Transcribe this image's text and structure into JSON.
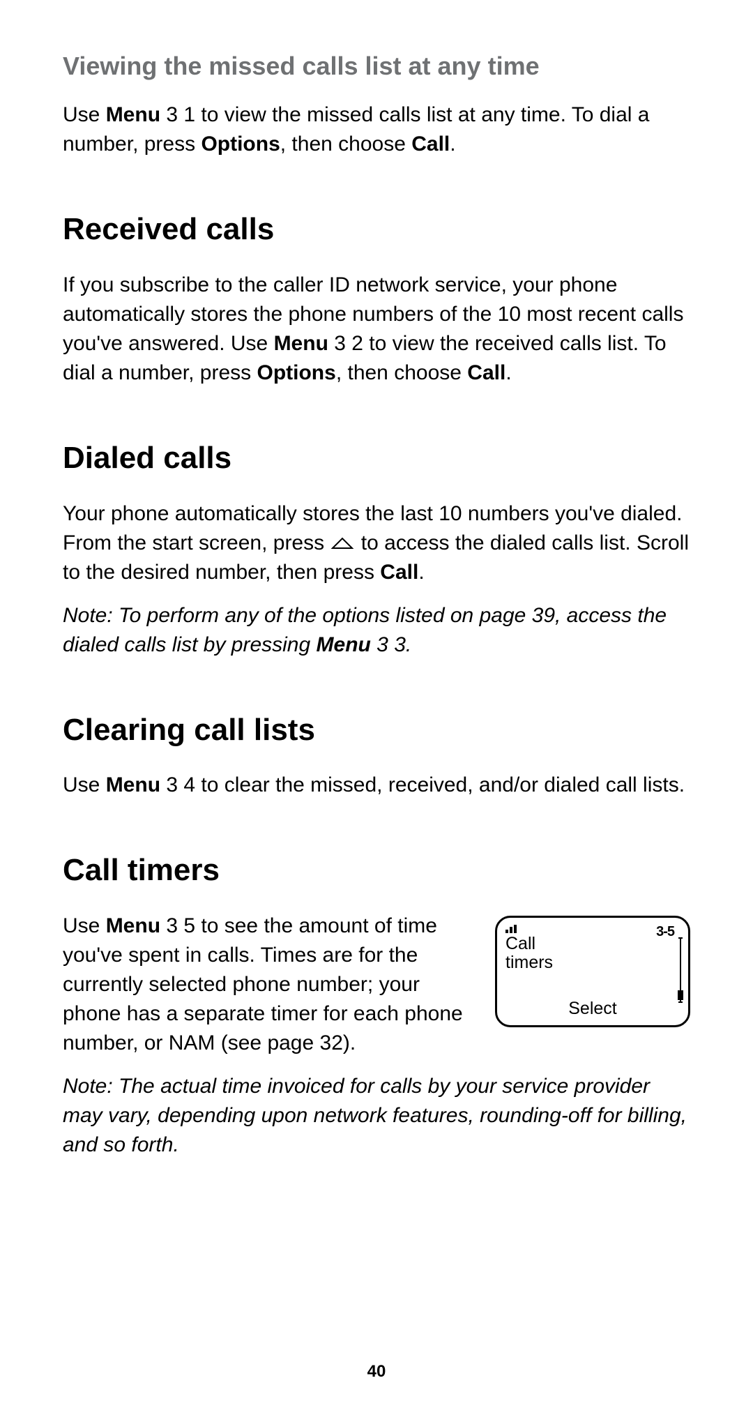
{
  "page_number": "40",
  "viewing": {
    "heading": "Viewing the missed calls list at any time",
    "t1": "Use ",
    "t2_bold": "Menu",
    "t3": " 3 1 to view the missed calls list at any time. To dial a number, press ",
    "t4_bold": "Options",
    "t5": ", then choose ",
    "t6_bold": "Call",
    "t7": "."
  },
  "received": {
    "heading": "Received calls",
    "t1": "If you subscribe to the caller ID network service, your phone automatically stores the phone numbers of the 10 most recent calls you've answered. Use ",
    "t2_bold": "Menu",
    "t3": " 3 2 to view the received calls list. To dial a number, press ",
    "t4_bold": "Options",
    "t5": ", then choose ",
    "t6_bold": "Call",
    "t7": "."
  },
  "dialed": {
    "heading": "Dialed calls",
    "t1": "Your phone automatically stores the last 10 numbers you've dialed. From the start screen, press ",
    "t2": " to access the dialed calls list. Scroll to the desired number, then press ",
    "t3_bold": "Call",
    "t4": ".",
    "note1": "Note:  To perform any of the options listed on page 39, access the dialed calls list by pressing ",
    "note2_bold": "Menu",
    "note3": " 3 3."
  },
  "clearing": {
    "heading": "Clearing call lists",
    "t1": "Use ",
    "t2_bold": "Menu",
    "t3": " 3 4 to clear the missed, received, and/or dialed call lists."
  },
  "timers": {
    "heading": "Call timers",
    "t1": "Use ",
    "t2_bold": "Menu",
    "t3": " 3 5 to see the amount of time you've spent in calls. Times are for the currently selected phone number; your phone has a separate timer for each phone number, or NAM (see page 32).",
    "note": "Note:  The actual time invoiced for calls by your service provider may vary, depending upon network features, rounding-off for billing, and so forth.",
    "screen": {
      "title_line1": "Call",
      "title_line2": "timers",
      "menu_num": "3-5",
      "select": "Select"
    }
  }
}
